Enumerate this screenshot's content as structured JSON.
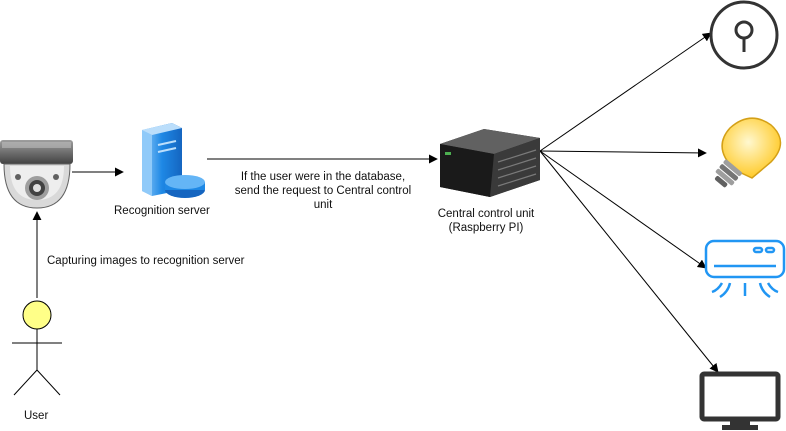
{
  "nodes": {
    "camera": {
      "icon": "dome-camera-icon"
    },
    "recognition_server": {
      "label": "Recognition server",
      "icon": "server-icon"
    },
    "central_unit": {
      "label_line1": "Central control unit",
      "label_line2": "(Raspberry PI)",
      "icon": "rack-server-icon"
    },
    "user": {
      "label": "User",
      "icon": "user-actor-icon"
    },
    "lock": {
      "icon": "lock-icon"
    },
    "light": {
      "icon": "light-bulb-icon"
    },
    "ac": {
      "icon": "air-conditioner-icon"
    },
    "tv": {
      "icon": "monitor-icon"
    }
  },
  "edges": {
    "user_to_camera": {
      "label": "Capturing images to recognition server"
    },
    "server_to_central": {
      "label_line1": "If the user were in the database,",
      "label_line2": "send the request to Central control",
      "label_line3": "unit"
    }
  },
  "colors": {
    "server_blue": "#1e88e5",
    "bulb_yellow": "#ffd54f",
    "actor_yellow": "#ffff88",
    "ac_blue": "#2196f3",
    "dark": "#333333"
  }
}
